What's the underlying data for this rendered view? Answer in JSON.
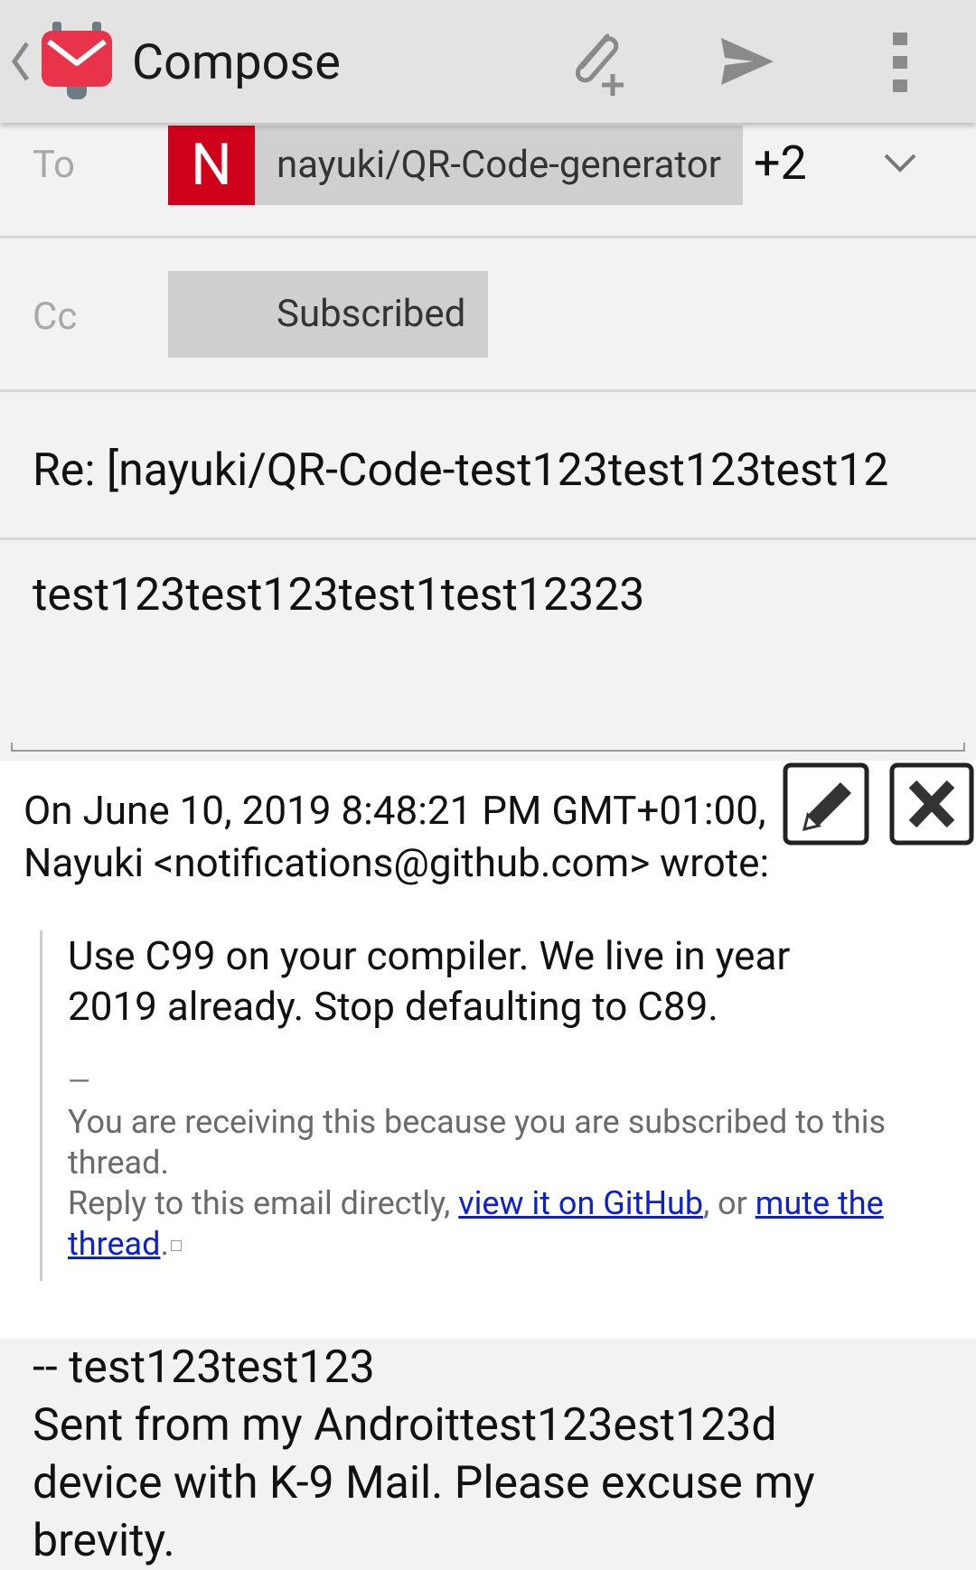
{
  "actionbar": {
    "title": "Compose",
    "icons": [
      "back-chevron-icon",
      "k9-mail-logo",
      "attach-icon",
      "send-icon",
      "overflow-menu-icon"
    ]
  },
  "to": {
    "label": "To",
    "chip_initial": "N",
    "chip_text": "nayuki/QR-Code-generator",
    "more_count": "+2",
    "avatar_color": "#d0021b"
  },
  "cc": {
    "label": "Cc",
    "chip_text": "Subscribed"
  },
  "subject": "Re: [nayuki/QR-Code-test123test123test12",
  "body": "test123test123test1test12323",
  "quote": {
    "header_line1": "On June 10, 2019 8:48:21 PM GMT+01:00,",
    "header_line2": "Nayuki <notifications@github.com> wrote:",
    "main_line1": "Use C99 on your compiler. We live in year",
    "main_line2": "2019 already. Stop defaulting to C89.",
    "dash": "—",
    "footer_line1": "You are receiving this because you are subscribed to this",
    "footer_line2": "thread.",
    "footer_line3_prefix": "Reply to this email directly, ",
    "link_view": "view it on GitHub",
    "footer_mid": ", or ",
    "link_mute_1": "mute the",
    "link_mute_2": "thread",
    "footer_end": "."
  },
  "signature": {
    "line1": "-- test123test123",
    "line2": "Sent from my Androittest123est123d",
    "line3": "device with K-9 Mail. Please excuse my",
    "line4": "brevity."
  },
  "colors": {
    "actionbar": "#e3e3e3",
    "link": "#0b1fd6",
    "logo_red": "#e8334a"
  }
}
